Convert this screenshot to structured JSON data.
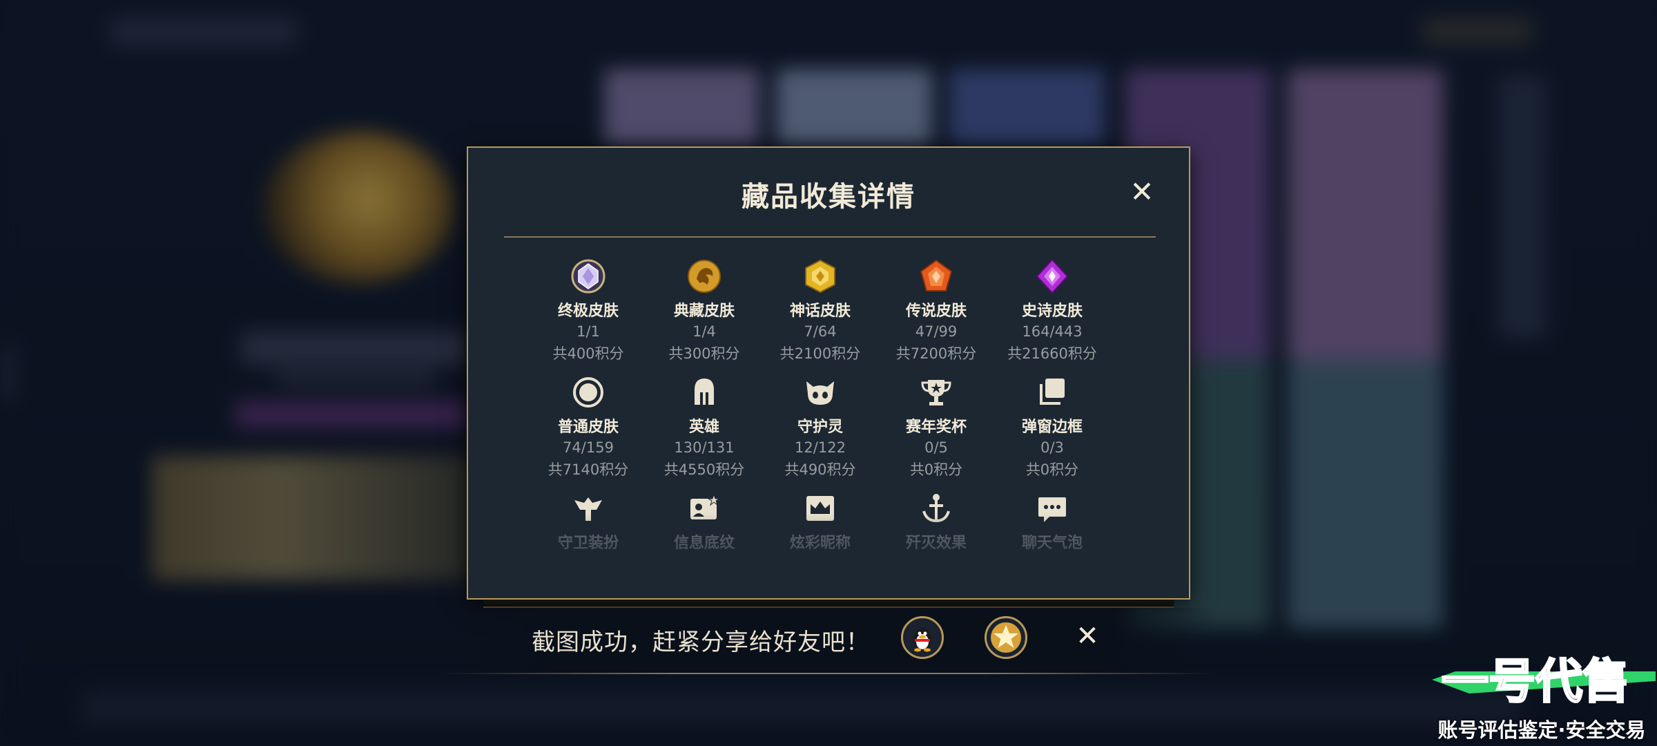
{
  "modal": {
    "title": "藏品收集详情",
    "categories": [
      {
        "name": "终极皮肤",
        "count": "1/1",
        "points": "共400积分",
        "icon": "ultimate-skin-icon"
      },
      {
        "name": "典藏皮肤",
        "count": "1/4",
        "points": "共300积分",
        "icon": "collector-skin-icon"
      },
      {
        "name": "神话皮肤",
        "count": "7/64",
        "points": "共2100积分",
        "icon": "mythic-skin-icon"
      },
      {
        "name": "传说皮肤",
        "count": "47/99",
        "points": "共7200积分",
        "icon": "legendary-skin-icon"
      },
      {
        "name": "史诗皮肤",
        "count": "164/443",
        "points": "共21660积分",
        "icon": "epic-skin-icon"
      },
      {
        "name": "普通皮肤",
        "count": "74/159",
        "points": "共7140积分",
        "icon": "normal-skin-icon"
      },
      {
        "name": "英雄",
        "count": "130/131",
        "points": "共4550积分",
        "icon": "hero-helmet-icon"
      },
      {
        "name": "守护灵",
        "count": "12/122",
        "points": "共490积分",
        "icon": "guardian-spirit-icon"
      },
      {
        "name": "赛年奖杯",
        "count": "0/5",
        "points": "共0积分",
        "icon": "trophy-icon"
      },
      {
        "name": "弹窗边框",
        "count": "0/3",
        "points": "共0积分",
        "icon": "popup-frame-icon"
      },
      {
        "name": "守卫装扮",
        "icon": "guard-outfit-icon"
      },
      {
        "name": "信息底纹",
        "icon": "info-background-icon"
      },
      {
        "name": "炫彩昵称",
        "icon": "colorful-nickname-icon"
      },
      {
        "name": "歼灭效果",
        "icon": "annihilation-effect-icon"
      },
      {
        "name": "聊天气泡",
        "icon": "chat-bubble-icon"
      }
    ]
  },
  "toast": {
    "text": "截图成功，赶紧分享给好友吧！",
    "share_buttons": [
      "qq-penguin-icon",
      "star-icon"
    ]
  },
  "watermark": {
    "logo_text": "一号代售",
    "subtitle": "账号评估鉴定·安全交易"
  },
  "colors": {
    "modal_bg": "#1c2732",
    "gold_border": "#b79a5a",
    "title_text": "#f1ead8",
    "muted_text": "#9a9d9f",
    "watermark_green": "#2fd36a",
    "watermark_purple": "#5b3bd6"
  }
}
